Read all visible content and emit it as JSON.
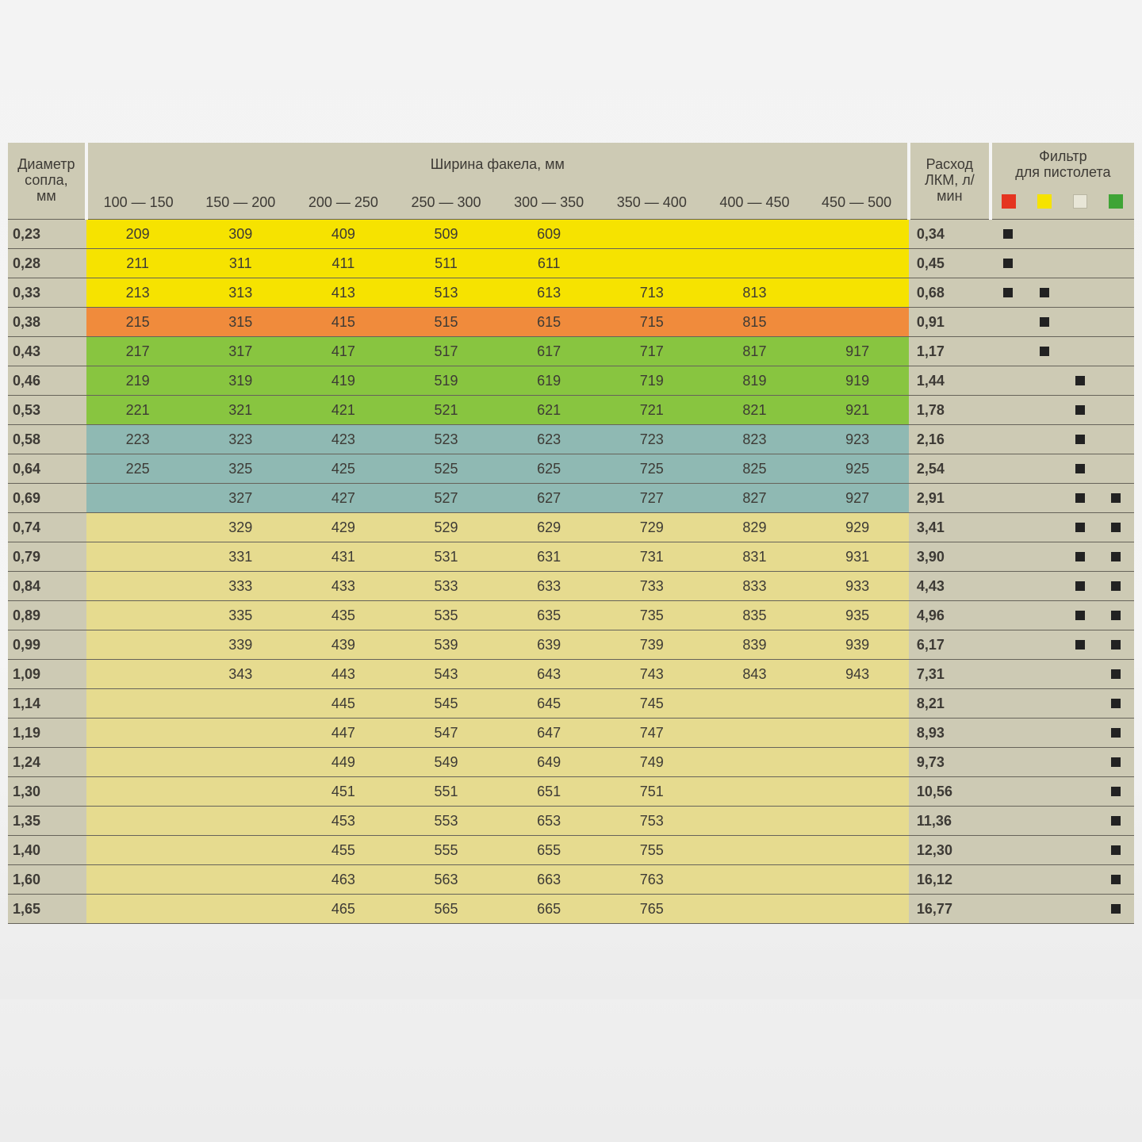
{
  "headers": {
    "diameter": "Диаметр\nсопла,\nмм",
    "width_title": "Ширина факела, мм",
    "width_cols": [
      "100 — 150",
      "150 — 200",
      "200 — 250",
      "250 — 300",
      "300 — 350",
      "350 — 400",
      "400 — 450",
      "450 — 500"
    ],
    "flow": "Расход\nЛКМ, л/\nмин",
    "filter": "Фильтр\nдля пистолета"
  },
  "filter_colors": [
    "red",
    "yellow",
    "white",
    "green"
  ],
  "band_colors": {
    "ylw": "#f6e300",
    "org": "#f08b3c",
    "grn": "#88c540",
    "teal": "#8fb9b3",
    "tan": "#e6db8f"
  },
  "chart_data": {
    "type": "table",
    "columns": [
      "diameter_mm",
      "100-150",
      "150-200",
      "200-250",
      "250-300",
      "300-350",
      "350-400",
      "400-450",
      "450-500",
      "flow_l_per_min",
      "filter_red",
      "filter_yellow",
      "filter_white",
      "filter_green",
      "row_band_color"
    ],
    "rows": [
      {
        "diameter": "0,23",
        "cells": [
          "209",
          "309",
          "409",
          "509",
          "609",
          "",
          "",
          ""
        ],
        "flow": "0,34",
        "filters": [
          true,
          false,
          false,
          false
        ],
        "band": "ylw"
      },
      {
        "diameter": "0,28",
        "cells": [
          "211",
          "311",
          "411",
          "511",
          "611",
          "",
          "",
          ""
        ],
        "flow": "0,45",
        "filters": [
          true,
          false,
          false,
          false
        ],
        "band": "ylw"
      },
      {
        "diameter": "0,33",
        "cells": [
          "213",
          "313",
          "413",
          "513",
          "613",
          "713",
          "813",
          ""
        ],
        "flow": "0,68",
        "filters": [
          true,
          true,
          false,
          false
        ],
        "band": "ylw"
      },
      {
        "diameter": "0,38",
        "cells": [
          "215",
          "315",
          "415",
          "515",
          "615",
          "715",
          "815",
          ""
        ],
        "flow": "0,91",
        "filters": [
          false,
          true,
          false,
          false
        ],
        "band": "org"
      },
      {
        "diameter": "0,43",
        "cells": [
          "217",
          "317",
          "417",
          "517",
          "617",
          "717",
          "817",
          "917"
        ],
        "flow": "1,17",
        "filters": [
          false,
          true,
          false,
          false
        ],
        "band": "grn"
      },
      {
        "diameter": "0,46",
        "cells": [
          "219",
          "319",
          "419",
          "519",
          "619",
          "719",
          "819",
          "919"
        ],
        "flow": "1,44",
        "filters": [
          false,
          false,
          true,
          false
        ],
        "band": "grn"
      },
      {
        "diameter": "0,53",
        "cells": [
          "221",
          "321",
          "421",
          "521",
          "621",
          "721",
          "821",
          "921"
        ],
        "flow": "1,78",
        "filters": [
          false,
          false,
          true,
          false
        ],
        "band": "grn"
      },
      {
        "diameter": "0,58",
        "cells": [
          "223",
          "323",
          "423",
          "523",
          "623",
          "723",
          "823",
          "923"
        ],
        "flow": "2,16",
        "filters": [
          false,
          false,
          true,
          false
        ],
        "band": "teal"
      },
      {
        "diameter": "0,64",
        "cells": [
          "225",
          "325",
          "425",
          "525",
          "625",
          "725",
          "825",
          "925"
        ],
        "flow": "2,54",
        "filters": [
          false,
          false,
          true,
          false
        ],
        "band": "teal"
      },
      {
        "diameter": "0,69",
        "cells": [
          "",
          "327",
          "427",
          "527",
          "627",
          "727",
          "827",
          "927"
        ],
        "flow": "2,91",
        "filters": [
          false,
          false,
          true,
          true
        ],
        "band": "teal"
      },
      {
        "diameter": "0,74",
        "cells": [
          "",
          "329",
          "429",
          "529",
          "629",
          "729",
          "829",
          "929"
        ],
        "flow": "3,41",
        "filters": [
          false,
          false,
          true,
          true
        ],
        "band": "tan"
      },
      {
        "diameter": "0,79",
        "cells": [
          "",
          "331",
          "431",
          "531",
          "631",
          "731",
          "831",
          "931"
        ],
        "flow": "3,90",
        "filters": [
          false,
          false,
          true,
          true
        ],
        "band": "tan"
      },
      {
        "diameter": "0,84",
        "cells": [
          "",
          "333",
          "433",
          "533",
          "633",
          "733",
          "833",
          "933"
        ],
        "flow": "4,43",
        "filters": [
          false,
          false,
          true,
          true
        ],
        "band": "tan"
      },
      {
        "diameter": "0,89",
        "cells": [
          "",
          "335",
          "435",
          "535",
          "635",
          "735",
          "835",
          "935"
        ],
        "flow": "4,96",
        "filters": [
          false,
          false,
          true,
          true
        ],
        "band": "tan"
      },
      {
        "diameter": "0,99",
        "cells": [
          "",
          "339",
          "439",
          "539",
          "639",
          "739",
          "839",
          "939"
        ],
        "flow": "6,17",
        "filters": [
          false,
          false,
          true,
          true
        ],
        "band": "tan"
      },
      {
        "diameter": "1,09",
        "cells": [
          "",
          "343",
          "443",
          "543",
          "643",
          "743",
          "843",
          "943"
        ],
        "flow": "7,31",
        "filters": [
          false,
          false,
          false,
          true
        ],
        "band": "tan"
      },
      {
        "diameter": "1,14",
        "cells": [
          "",
          "",
          "445",
          "545",
          "645",
          "745",
          "",
          ""
        ],
        "flow": "8,21",
        "filters": [
          false,
          false,
          false,
          true
        ],
        "band": "tan"
      },
      {
        "diameter": "1,19",
        "cells": [
          "",
          "",
          "447",
          "547",
          "647",
          "747",
          "",
          ""
        ],
        "flow": "8,93",
        "filters": [
          false,
          false,
          false,
          true
        ],
        "band": "tan"
      },
      {
        "diameter": "1,24",
        "cells": [
          "",
          "",
          "449",
          "549",
          "649",
          "749",
          "",
          ""
        ],
        "flow": "9,73",
        "filters": [
          false,
          false,
          false,
          true
        ],
        "band": "tan"
      },
      {
        "diameter": "1,30",
        "cells": [
          "",
          "",
          "451",
          "551",
          "651",
          "751",
          "",
          ""
        ],
        "flow": "10,56",
        "filters": [
          false,
          false,
          false,
          true
        ],
        "band": "tan"
      },
      {
        "diameter": "1,35",
        "cells": [
          "",
          "",
          "453",
          "553",
          "653",
          "753",
          "",
          ""
        ],
        "flow": "11,36",
        "filters": [
          false,
          false,
          false,
          true
        ],
        "band": "tan"
      },
      {
        "diameter": "1,40",
        "cells": [
          "",
          "",
          "455",
          "555",
          "655",
          "755",
          "",
          ""
        ],
        "flow": "12,30",
        "filters": [
          false,
          false,
          false,
          true
        ],
        "band": "tan"
      },
      {
        "diameter": "1,60",
        "cells": [
          "",
          "",
          "463",
          "563",
          "663",
          "763",
          "",
          ""
        ],
        "flow": "16,12",
        "filters": [
          false,
          false,
          false,
          true
        ],
        "band": "tan"
      },
      {
        "diameter": "1,65",
        "cells": [
          "",
          "",
          "465",
          "565",
          "665",
          "765",
          "",
          ""
        ],
        "flow": "16,77",
        "filters": [
          false,
          false,
          false,
          true
        ],
        "band": "tan"
      }
    ]
  }
}
